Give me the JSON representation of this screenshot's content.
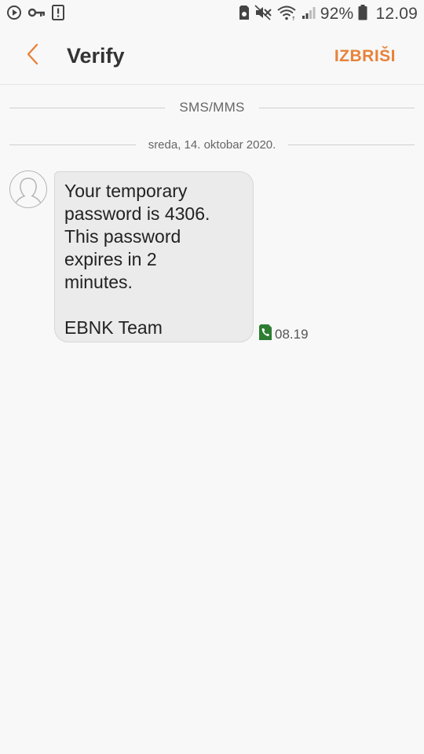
{
  "status_bar": {
    "battery_percent": "92%",
    "time": "12.09",
    "icons": [
      "media-play-icon",
      "vpn-key-icon",
      "alert-icon",
      "sim-icon",
      "mute-icon",
      "wifi-icon",
      "signal-icon",
      "battery-icon"
    ]
  },
  "header": {
    "title": "Verify",
    "delete_label": "IZBRIŠI",
    "accent_color": "#e8823a"
  },
  "conversation": {
    "channel_label": "SMS/MMS",
    "date_label": "sreda, 14. oktobar 2020.",
    "messages": [
      {
        "text": "Your temporary\npassword is 4306.\nThis password\nexpires in 2\nminutes.\n\nEBNK Team",
        "time": "08.19",
        "sim_icon": "sim-phone-icon",
        "sim_color": "#2e7d32"
      }
    ]
  }
}
